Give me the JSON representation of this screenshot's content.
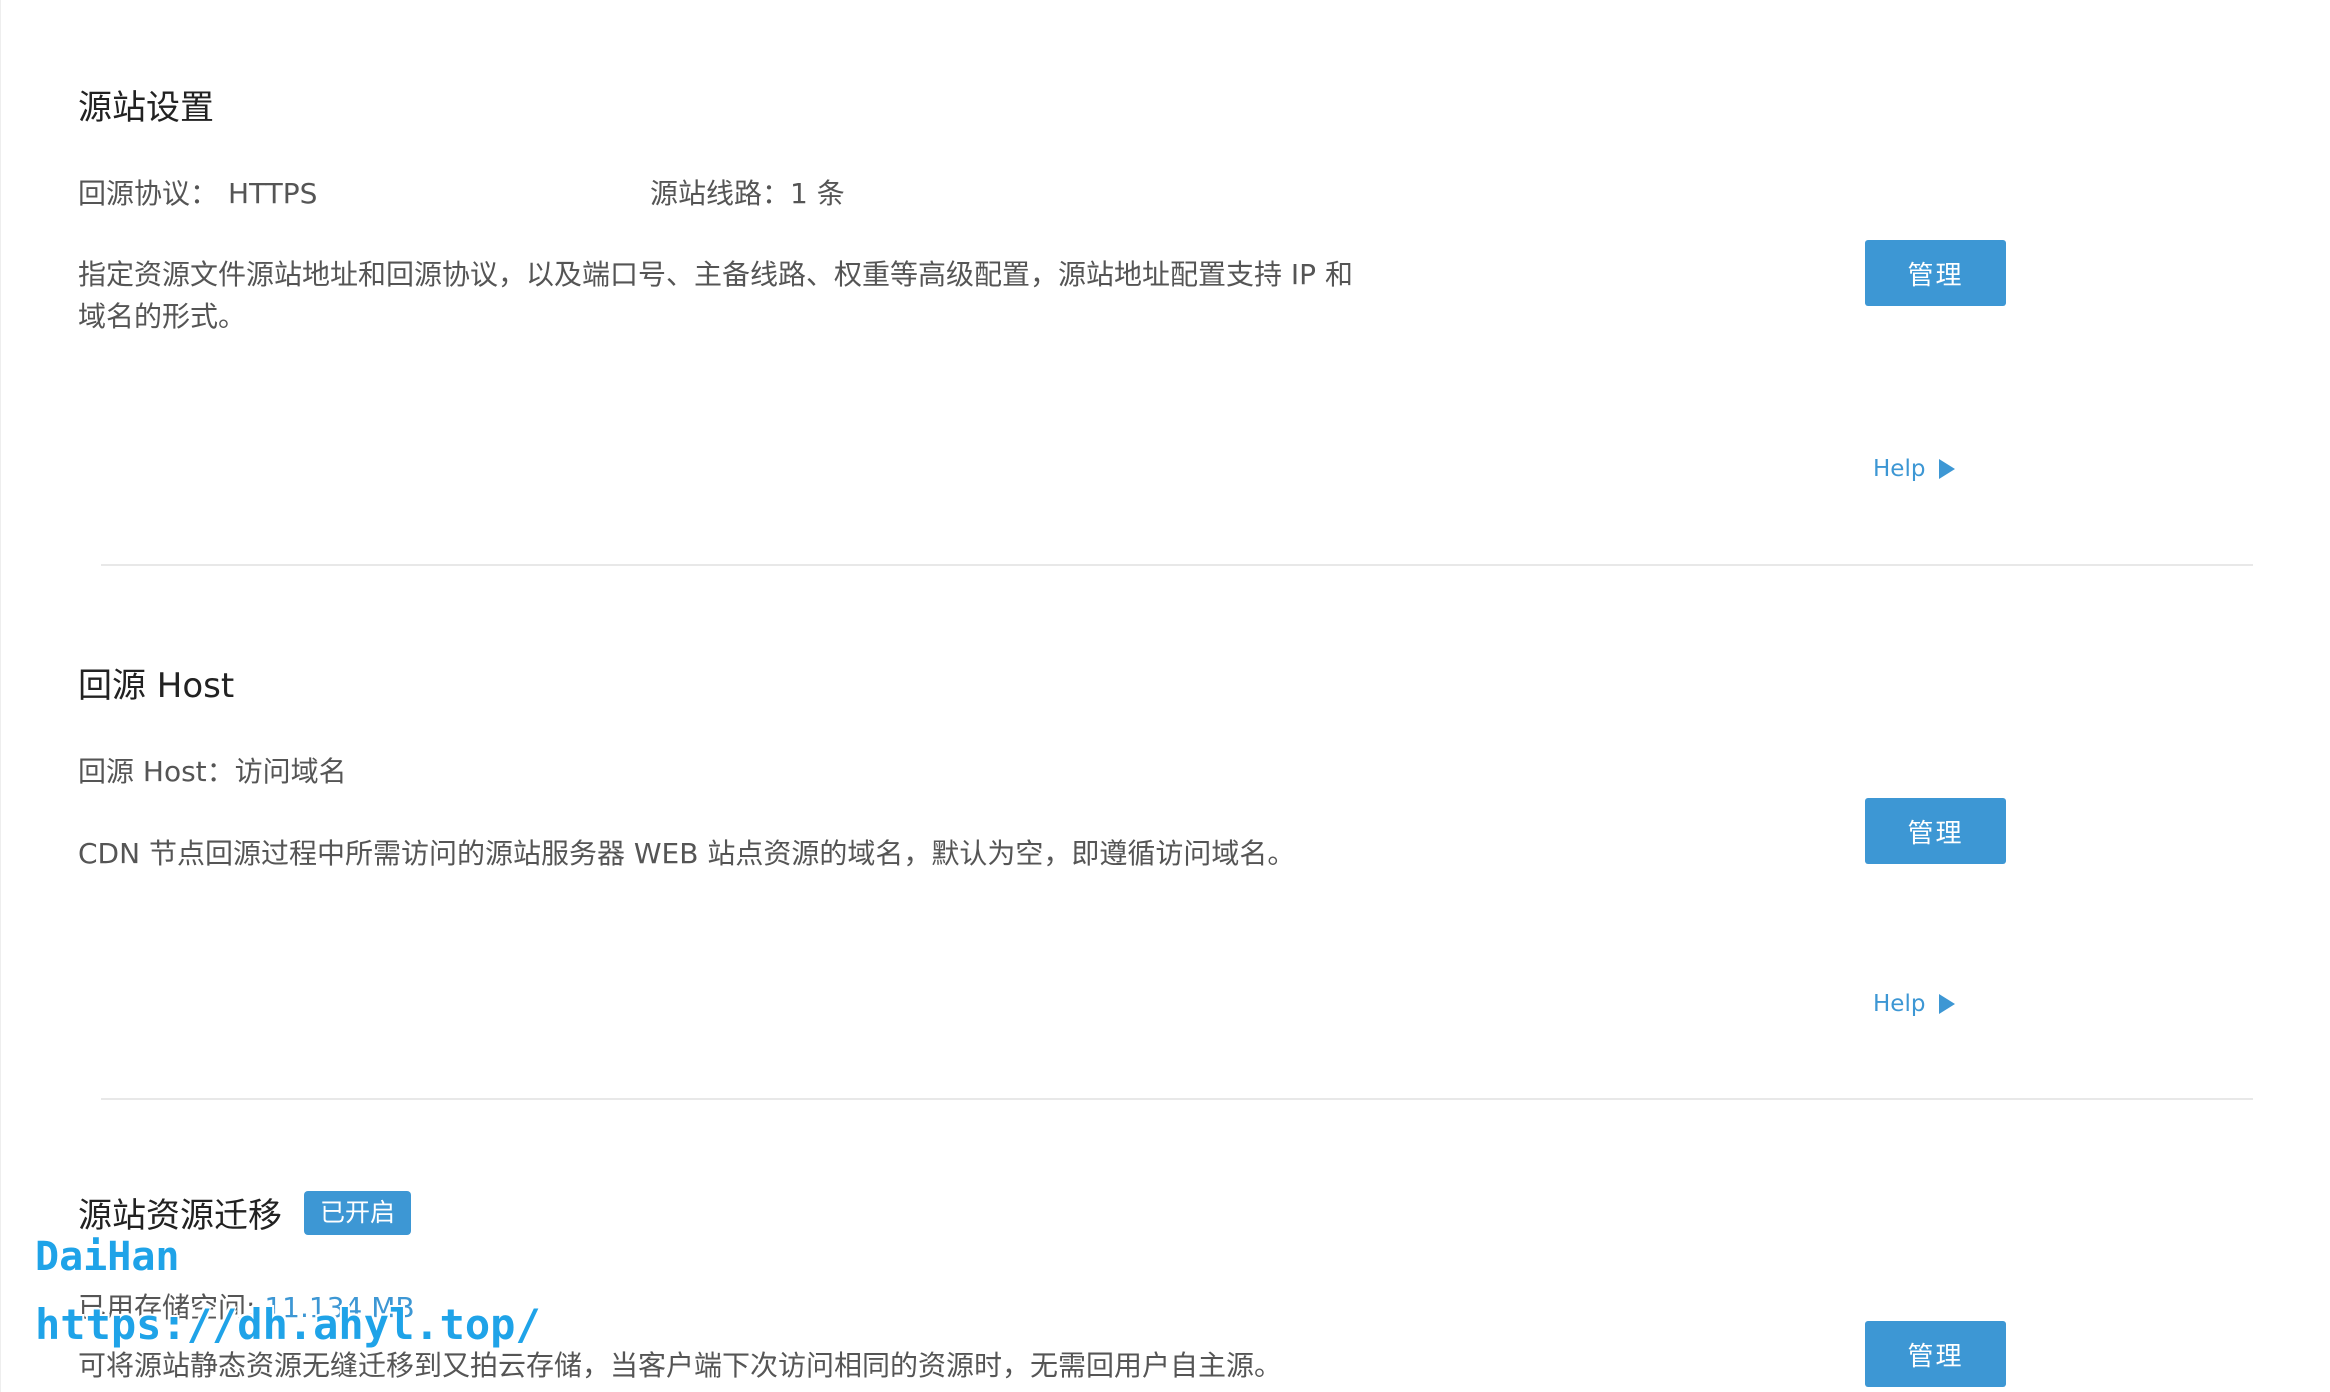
{
  "origin_settings": {
    "title": "源站设置",
    "protocol_label": "回源协议：",
    "protocol_value": "HTTPS",
    "lines_label": "源站线路：",
    "lines_value": "1 条",
    "description_line1": "指定资源文件源站地址和回源协议，以及端口号、主备线路、权重等高级配置，源站地址配置支持 IP 和",
    "description_line2": "域名的形式。",
    "manage_label": "管理",
    "help_label": "Help"
  },
  "origin_host": {
    "title": "回源 Host",
    "host_label": "回源 Host：",
    "host_value": "访问域名",
    "description": "CDN 节点回源过程中所需访问的源站服务器 WEB 站点资源的域名，默认为空，即遵循访问域名。",
    "manage_label": "管理",
    "help_label": "Help"
  },
  "origin_migration": {
    "title": "源站资源迁移",
    "status_badge": "已开启",
    "storage_label": "已用存储空间: ",
    "storage_value": "11.134 MB",
    "description": "可将源站静态资源无缝迁移到又拍云存储，当客户端下次访问相同的资源时，无需回用户自主源。",
    "manage_label": "管理"
  },
  "watermark": {
    "line1": "DaiHan",
    "line2": "https://dh.ahyl.top/"
  },
  "colors": {
    "accent": "#3d97d4",
    "watermark": "#1fa3e8"
  }
}
